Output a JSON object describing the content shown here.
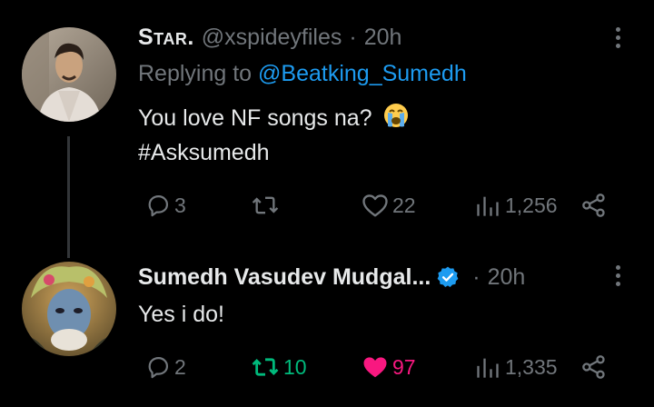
{
  "colors": {
    "background": "#000000",
    "text": "#e7e9ea",
    "muted": "#71767b",
    "link": "#1d9bf0",
    "retweet_active": "#00ba7c",
    "like_active": "#f91880",
    "thread_line": "#333639"
  },
  "tweets": [
    {
      "display_name": "Star.",
      "handle": "@xspideyfiles",
      "separator": "·",
      "time": "20h",
      "replying_label": "Replying to",
      "replying_to": "@Beatking_Sumedh",
      "text": "You love NF songs na?",
      "emoji": "loudly-crying-face-icon",
      "hashtag": "#Asksumedh",
      "actions": {
        "replies": "3",
        "retweets": "",
        "likes": "22",
        "views": "1,256"
      }
    },
    {
      "display_name": "Sumedh Vasudev Mudgal...",
      "verified": true,
      "separator": "·",
      "time": "20h",
      "text": "Yes i do!",
      "actions": {
        "replies": "2",
        "retweets": "10",
        "likes": "97",
        "views": "1,335"
      }
    }
  ]
}
